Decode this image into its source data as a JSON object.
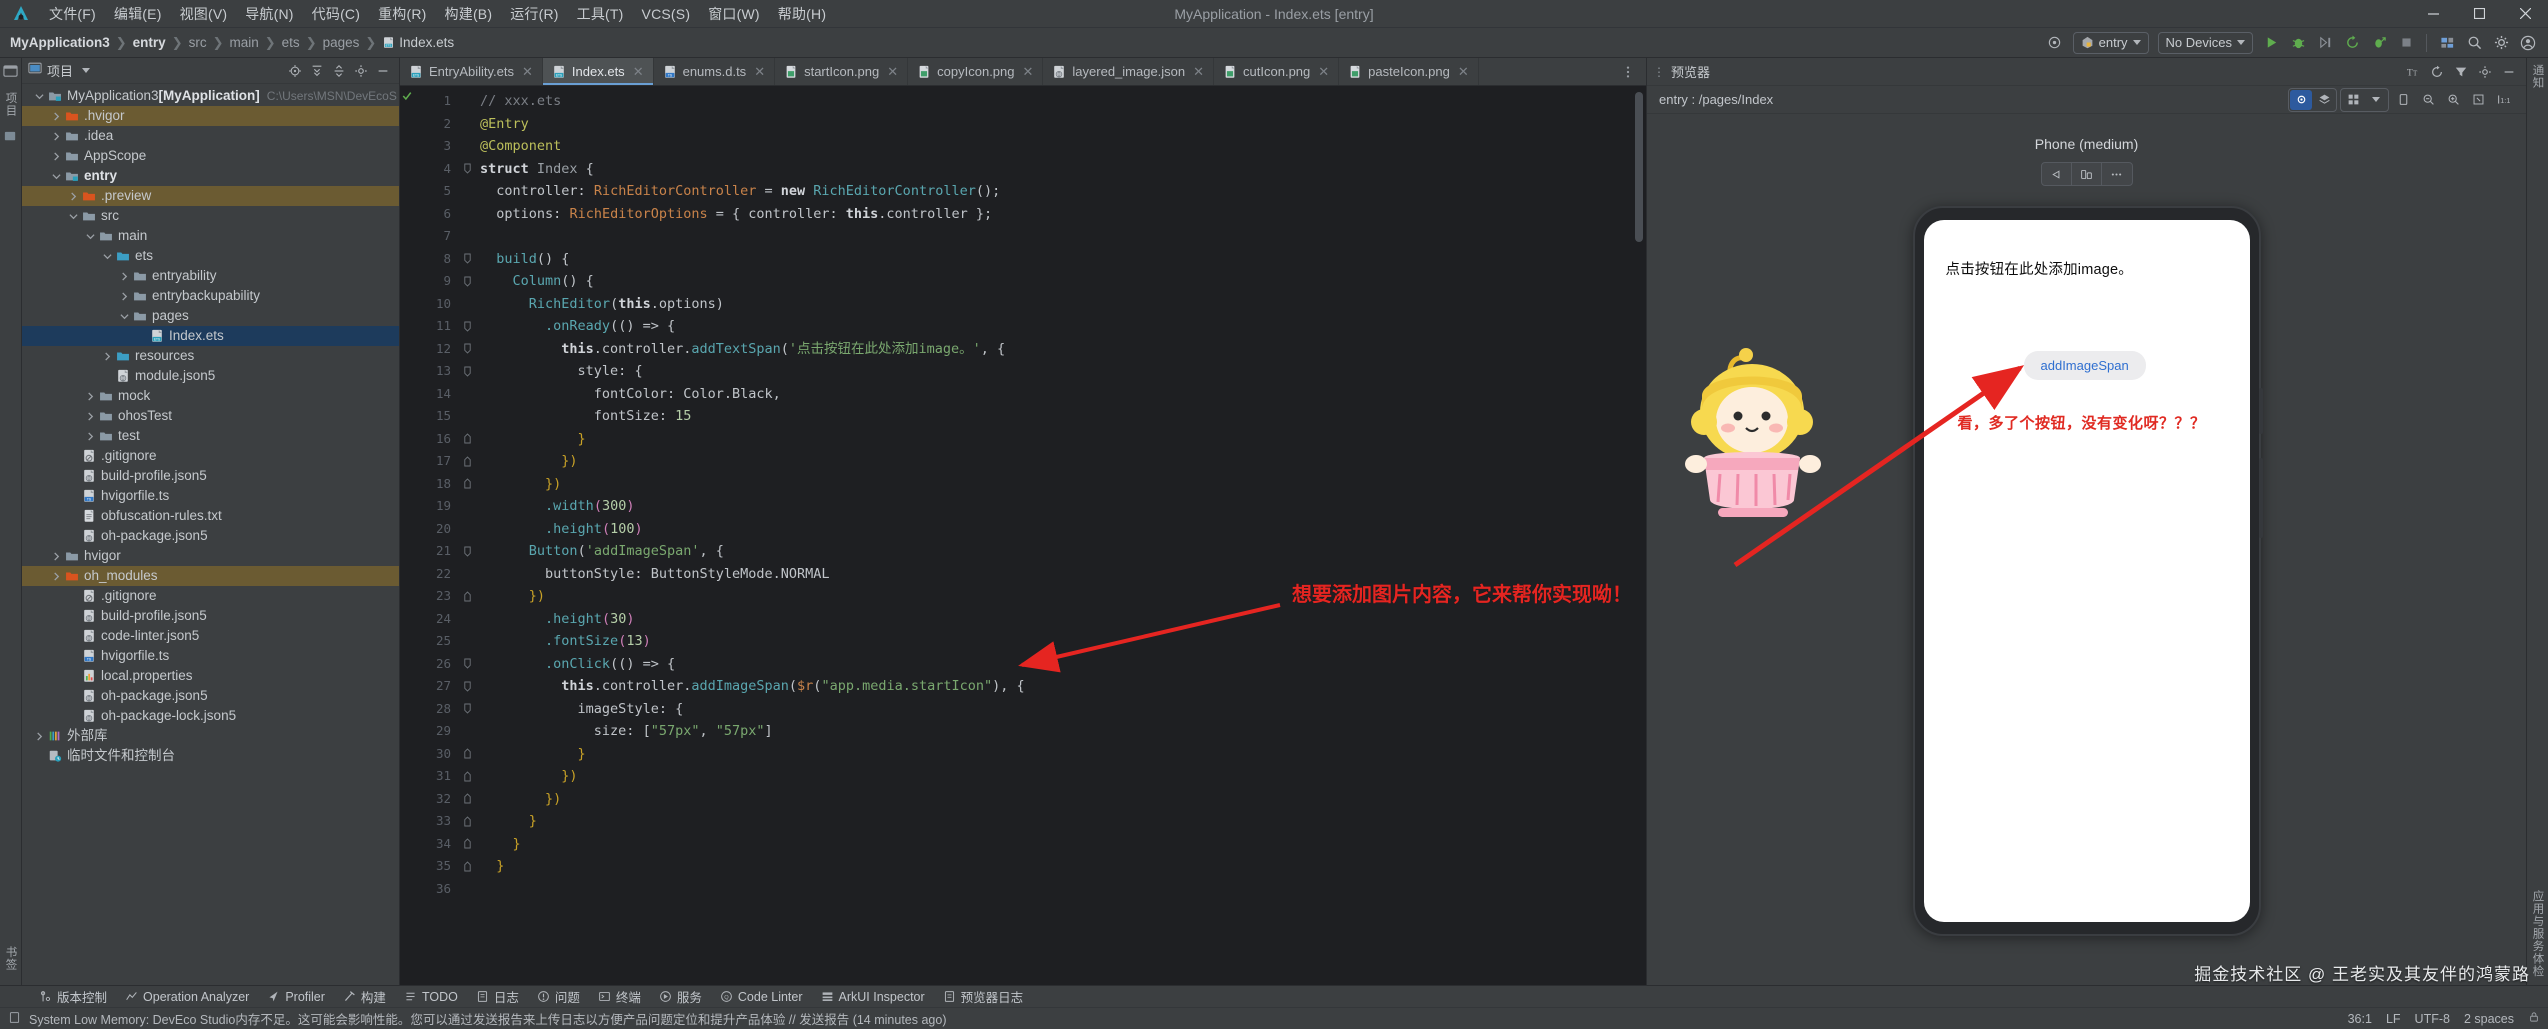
{
  "window": {
    "title": "MyApplication - Index.ets [entry]",
    "menu": [
      "文件(F)",
      "编辑(E)",
      "视图(V)",
      "导航(N)",
      "代码(C)",
      "重构(R)",
      "构建(B)",
      "运行(R)",
      "工具(T)",
      "VCS(S)",
      "窗口(W)",
      "帮助(H)"
    ],
    "controls": {
      "minimize": "minimize-icon",
      "maximize": "maximize-icon",
      "close": "close-icon"
    }
  },
  "navbar": {
    "breadcrumb": [
      "MyApplication3",
      "entry",
      "src",
      "main",
      "ets",
      "pages",
      "Index.ets"
    ],
    "run_config": "entry",
    "device": "No Devices",
    "icons": [
      "settings-target-icon",
      "run-icon",
      "debug-icon",
      "profile-run-icon",
      "rerun-icon",
      "attach-debugger-icon",
      "stop-icon",
      "device-manager-icon",
      "search-everywhere-icon",
      "settings-gear-icon",
      "account-icon"
    ]
  },
  "left_rail": {
    "items": [
      "项目",
      "结构",
      "书签"
    ]
  },
  "project_panel": {
    "title": "项目",
    "header_icons": [
      "locate-icon",
      "expand-all-icon",
      "collapse-all-icon",
      "settings-icon",
      "hide-icon"
    ],
    "tree": [
      {
        "depth": 0,
        "label": "MyApplication3",
        "bold_label": "[MyApplication]",
        "path": "C:\\Users\\MSN\\DevEcoS",
        "icon": "module-folder",
        "arrow": "down",
        "state": "normal"
      },
      {
        "depth": 1,
        "label": ".hvigor",
        "icon": "folder-orange",
        "arrow": "right",
        "state": "hl"
      },
      {
        "depth": 1,
        "label": ".idea",
        "icon": "folder",
        "arrow": "right",
        "state": "normal"
      },
      {
        "depth": 1,
        "label": "AppScope",
        "icon": "folder",
        "arrow": "right",
        "state": "normal"
      },
      {
        "depth": 1,
        "label": "entry",
        "icon": "module-folder",
        "arrow": "down",
        "state": "normal",
        "bold": true
      },
      {
        "depth": 2,
        "label": ".preview",
        "icon": "folder-orange",
        "arrow": "right",
        "state": "hl"
      },
      {
        "depth": 2,
        "label": "src",
        "icon": "folder",
        "arrow": "down",
        "state": "normal"
      },
      {
        "depth": 3,
        "label": "main",
        "icon": "folder",
        "arrow": "down",
        "state": "normal"
      },
      {
        "depth": 4,
        "label": "ets",
        "icon": "folder-blue",
        "arrow": "down",
        "state": "normal"
      },
      {
        "depth": 5,
        "label": "entryability",
        "icon": "folder",
        "arrow": "right",
        "state": "normal"
      },
      {
        "depth": 5,
        "label": "entrybackupability",
        "icon": "folder",
        "arrow": "right",
        "state": "normal"
      },
      {
        "depth": 5,
        "label": "pages",
        "icon": "folder",
        "arrow": "down",
        "state": "normal"
      },
      {
        "depth": 6,
        "label": "Index.ets",
        "icon": "ets-file",
        "arrow": "none",
        "state": "sel"
      },
      {
        "depth": 4,
        "label": "resources",
        "icon": "folder-blue",
        "arrow": "right",
        "state": "normal"
      },
      {
        "depth": 4,
        "label": "module.json5",
        "icon": "json5-file",
        "arrow": "none",
        "state": "normal"
      },
      {
        "depth": 3,
        "label": "mock",
        "icon": "folder",
        "arrow": "right",
        "state": "normal"
      },
      {
        "depth": 3,
        "label": "ohosTest",
        "icon": "folder",
        "arrow": "right",
        "state": "normal"
      },
      {
        "depth": 3,
        "label": "test",
        "icon": "folder",
        "arrow": "right",
        "state": "normal"
      },
      {
        "depth": 2,
        "label": ".gitignore",
        "icon": "gitignore-file",
        "arrow": "none",
        "state": "normal"
      },
      {
        "depth": 2,
        "label": "build-profile.json5",
        "icon": "json5-file",
        "arrow": "none",
        "state": "normal"
      },
      {
        "depth": 2,
        "label": "hvigorfile.ts",
        "icon": "ts-file",
        "arrow": "none",
        "state": "normal"
      },
      {
        "depth": 2,
        "label": "obfuscation-rules.txt",
        "icon": "txt-file",
        "arrow": "none",
        "state": "normal"
      },
      {
        "depth": 2,
        "label": "oh-package.json5",
        "icon": "json5-file",
        "arrow": "none",
        "state": "normal"
      },
      {
        "depth": 1,
        "label": "hvigor",
        "icon": "folder",
        "arrow": "right",
        "state": "normal"
      },
      {
        "depth": 1,
        "label": "oh_modules",
        "icon": "folder-orange",
        "arrow": "right",
        "state": "hl"
      },
      {
        "depth": 2,
        "label": ".gitignore",
        "icon": "gitignore-file",
        "arrow": "none",
        "state": "normal"
      },
      {
        "depth": 2,
        "label": "build-profile.json5",
        "icon": "json5-file",
        "arrow": "none",
        "state": "normal"
      },
      {
        "depth": 2,
        "label": "code-linter.json5",
        "icon": "json5-file",
        "arrow": "none",
        "state": "normal"
      },
      {
        "depth": 2,
        "label": "hvigorfile.ts",
        "icon": "ts-file",
        "arrow": "none",
        "state": "normal"
      },
      {
        "depth": 2,
        "label": "local.properties",
        "icon": "properties-file",
        "arrow": "none",
        "state": "normal"
      },
      {
        "depth": 2,
        "label": "oh-package.json5",
        "icon": "json5-file",
        "arrow": "none",
        "state": "normal"
      },
      {
        "depth": 2,
        "label": "oh-package-lock.json5",
        "icon": "json5-file",
        "arrow": "none",
        "state": "normal"
      },
      {
        "depth": 0,
        "label": "外部库",
        "icon": "library-icon",
        "arrow": "right",
        "state": "normal"
      },
      {
        "depth": 0,
        "label": "临时文件和控制台",
        "icon": "scratches-icon",
        "arrow": "none",
        "state": "normal"
      }
    ]
  },
  "editor": {
    "tabs": [
      {
        "label": "EntryAbility.ets",
        "icon": "ets-file",
        "active": false
      },
      {
        "label": "Index.ets",
        "icon": "ets-file",
        "active": true
      },
      {
        "label": "enums.d.ts",
        "icon": "ts-file",
        "active": false
      },
      {
        "label": "startIcon.png",
        "icon": "png-file",
        "active": false
      },
      {
        "label": "copyIcon.png",
        "icon": "png-file",
        "active": false
      },
      {
        "label": "layered_image.json",
        "icon": "json-file",
        "active": false
      },
      {
        "label": "cutIcon.png",
        "icon": "png-file",
        "active": false
      },
      {
        "label": "pasteIcon.png",
        "icon": "png-file",
        "active": false
      }
    ],
    "first_line": 1,
    "last_line": 36,
    "lines": [
      {
        "n": 1,
        "indent": 0,
        "tokens": [
          {
            "t": "// xxx.ets",
            "c": "k-cmt"
          }
        ]
      },
      {
        "n": 2,
        "indent": 0,
        "tokens": [
          {
            "t": "@Entry",
            "c": "k-ann"
          }
        ]
      },
      {
        "n": 3,
        "indent": 0,
        "tokens": [
          {
            "t": "@Component",
            "c": "k-ann"
          }
        ]
      },
      {
        "n": 4,
        "indent": 0,
        "fold": "open",
        "tokens": [
          {
            "t": "struct ",
            "c": "k-kw"
          },
          {
            "t": "Index",
            "c": "k-id"
          },
          {
            "t": " {",
            "c": "k-plain"
          }
        ]
      },
      {
        "n": 5,
        "indent": 1,
        "tokens": [
          {
            "t": "controller",
            "c": "k-plain"
          },
          {
            "t": ": ",
            "c": "k-plain"
          },
          {
            "t": "RichEditorController",
            "c": "k-type"
          },
          {
            "t": " = ",
            "c": "k-plain"
          },
          {
            "t": "new ",
            "c": "k-kw"
          },
          {
            "t": "RichEditorController",
            "c": "k-fn"
          },
          {
            "t": "();",
            "c": "k-plain"
          }
        ]
      },
      {
        "n": 6,
        "indent": 1,
        "tokens": [
          {
            "t": "options",
            "c": "k-plain"
          },
          {
            "t": ": ",
            "c": "k-plain"
          },
          {
            "t": "RichEditorOptions",
            "c": "k-type"
          },
          {
            "t": " = { controller: ",
            "c": "k-plain"
          },
          {
            "t": "this",
            "c": "k-kw"
          },
          {
            "t": ".controller };",
            "c": "k-plain"
          }
        ]
      },
      {
        "n": 7,
        "indent": 0,
        "tokens": []
      },
      {
        "n": 8,
        "indent": 1,
        "fold": "open",
        "tokens": [
          {
            "t": "build",
            "c": "k-fn"
          },
          {
            "t": "() {",
            "c": "k-plain"
          }
        ]
      },
      {
        "n": 9,
        "indent": 2,
        "fold": "open",
        "tokens": [
          {
            "t": "Column",
            "c": "k-fn"
          },
          {
            "t": "() {",
            "c": "k-plain"
          }
        ]
      },
      {
        "n": 10,
        "indent": 3,
        "tokens": [
          {
            "t": "RichEditor",
            "c": "k-fn"
          },
          {
            "t": "(",
            "c": "k-plain"
          },
          {
            "t": "this",
            "c": "k-kw"
          },
          {
            "t": ".options)",
            "c": "k-plain"
          }
        ]
      },
      {
        "n": 11,
        "indent": 4,
        "fold": "open",
        "tokens": [
          {
            "t": ".onReady",
            "c": "k-fn"
          },
          {
            "t": "(() => {",
            "c": "k-plain"
          }
        ]
      },
      {
        "n": 12,
        "indent": 5,
        "fold": "open",
        "tokens": [
          {
            "t": "this",
            "c": "k-kw"
          },
          {
            "t": ".controller.",
            "c": "k-plain"
          },
          {
            "t": "addTextSpan",
            "c": "k-fn"
          },
          {
            "t": "(",
            "c": "k-plain"
          },
          {
            "t": "'点击按钮在此处添加image。'",
            "c": "k-str"
          },
          {
            "t": ", {",
            "c": "k-plain"
          }
        ]
      },
      {
        "n": 13,
        "indent": 6,
        "fold": "open",
        "tokens": [
          {
            "t": "style: {",
            "c": "k-plain"
          }
        ]
      },
      {
        "n": 14,
        "indent": 7,
        "tokens": [
          {
            "t": "fontColor: Color.Black,",
            "c": "k-plain"
          }
        ]
      },
      {
        "n": 15,
        "indent": 7,
        "tokens": [
          {
            "t": "fontSize: ",
            "c": "k-plain"
          },
          {
            "t": "15",
            "c": "k-num"
          }
        ]
      },
      {
        "n": 16,
        "indent": 6,
        "fold": "close",
        "tokens": [
          {
            "t": "}",
            "c": "k-brk"
          }
        ]
      },
      {
        "n": 17,
        "indent": 5,
        "fold": "close",
        "tokens": [
          {
            "t": "})",
            "c": "k-brk"
          }
        ]
      },
      {
        "n": 18,
        "indent": 4,
        "fold": "close",
        "tokens": [
          {
            "t": "})",
            "c": "k-brk"
          }
        ]
      },
      {
        "n": 19,
        "indent": 4,
        "tokens": [
          {
            "t": ".width",
            "c": "k-fn"
          },
          {
            "t": "(",
            "c": "k-paren-pink"
          },
          {
            "t": "300",
            "c": "k-num"
          },
          {
            "t": ")",
            "c": "k-paren-pink"
          }
        ]
      },
      {
        "n": 20,
        "indent": 4,
        "tokens": [
          {
            "t": ".height",
            "c": "k-fn"
          },
          {
            "t": "(",
            "c": "k-paren-pink"
          },
          {
            "t": "100",
            "c": "k-num"
          },
          {
            "t": ")",
            "c": "k-paren-pink"
          }
        ]
      },
      {
        "n": 21,
        "indent": 3,
        "fold": "open",
        "tokens": [
          {
            "t": "Button",
            "c": "k-fn"
          },
          {
            "t": "(",
            "c": "k-plain"
          },
          {
            "t": "'addImageSpan'",
            "c": "k-str"
          },
          {
            "t": ", {",
            "c": "k-plain"
          }
        ]
      },
      {
        "n": 22,
        "indent": 4,
        "tokens": [
          {
            "t": "buttonStyle: ButtonStyleMode.NORMAL",
            "c": "k-plain"
          }
        ]
      },
      {
        "n": 23,
        "indent": 3,
        "fold": "close",
        "tokens": [
          {
            "t": "})",
            "c": "k-brk"
          }
        ]
      },
      {
        "n": 24,
        "indent": 4,
        "tokens": [
          {
            "t": ".height",
            "c": "k-fn"
          },
          {
            "t": "(",
            "c": "k-paren-pink"
          },
          {
            "t": "30",
            "c": "k-num"
          },
          {
            "t": ")",
            "c": "k-paren-pink"
          }
        ]
      },
      {
        "n": 25,
        "indent": 4,
        "tokens": [
          {
            "t": ".fontSize",
            "c": "k-fn"
          },
          {
            "t": "(",
            "c": "k-paren-pink"
          },
          {
            "t": "13",
            "c": "k-num"
          },
          {
            "t": ")",
            "c": "k-paren-pink"
          }
        ]
      },
      {
        "n": 26,
        "indent": 4,
        "fold": "open",
        "tokens": [
          {
            "t": ".onClick",
            "c": "k-fn"
          },
          {
            "t": "(() => {",
            "c": "k-plain"
          }
        ]
      },
      {
        "n": 27,
        "indent": 5,
        "fold": "open",
        "tokens": [
          {
            "t": "this",
            "c": "k-kw"
          },
          {
            "t": ".controller.",
            "c": "k-plain"
          },
          {
            "t": "addImageSpan",
            "c": "k-fn"
          },
          {
            "t": "(",
            "c": "k-plain"
          },
          {
            "t": "$r",
            "c": "k-dollar"
          },
          {
            "t": "(",
            "c": "k-plain"
          },
          {
            "t": "\"app.media.startIcon\"",
            "c": "k-str"
          },
          {
            "t": "), {",
            "c": "k-plain"
          }
        ]
      },
      {
        "n": 28,
        "indent": 6,
        "fold": "open",
        "tokens": [
          {
            "t": "imageStyle: {",
            "c": "k-plain"
          }
        ]
      },
      {
        "n": 29,
        "indent": 7,
        "tokens": [
          {
            "t": "size: [",
            "c": "k-plain"
          },
          {
            "t": "\"57px\"",
            "c": "k-str"
          },
          {
            "t": ", ",
            "c": "k-plain"
          },
          {
            "t": "\"57px\"",
            "c": "k-str"
          },
          {
            "t": "]",
            "c": "k-plain"
          }
        ]
      },
      {
        "n": 30,
        "indent": 6,
        "fold": "close",
        "tokens": [
          {
            "t": "}",
            "c": "k-brk"
          }
        ]
      },
      {
        "n": 31,
        "indent": 5,
        "fold": "close",
        "tokens": [
          {
            "t": "})",
            "c": "k-brk"
          }
        ]
      },
      {
        "n": 32,
        "indent": 4,
        "fold": "close",
        "tokens": [
          {
            "t": "})",
            "c": "k-brk"
          }
        ]
      },
      {
        "n": 33,
        "indent": 3,
        "fold": "close",
        "tokens": [
          {
            "t": "}",
            "c": "k-brk"
          }
        ]
      },
      {
        "n": 34,
        "indent": 2,
        "fold": "close",
        "tokens": [
          {
            "t": "}",
            "c": "k-brk"
          }
        ]
      },
      {
        "n": 35,
        "indent": 1,
        "fold": "close",
        "tokens": [
          {
            "t": "}",
            "c": "k-brk"
          }
        ]
      },
      {
        "n": 36,
        "indent": 0,
        "tokens": []
      }
    ]
  },
  "preview": {
    "title": "预览器",
    "route": "entry : /pages/Index",
    "device_name": "Phone (medium)",
    "header_icons": [
      "text-size-icon",
      "refresh-icon",
      "filter-icon",
      "settings-icon",
      "hide-icon"
    ],
    "sub_icons": [
      "inspector-icon",
      "layers-icon",
      "grid-icon",
      "chevron-down-icon",
      "device-frame-icon",
      "zoom-out-icon",
      "zoom-in-icon",
      "fit-screen-icon",
      "actual-size-icon"
    ],
    "mini_icons": [
      "rotate-left-icon",
      "orientation-icon",
      "more-icon"
    ],
    "screen": {
      "rich_text": "点击按钮在此处添加image。",
      "button_label": "addImageSpan",
      "note": "看，多了个按钮，没有变化呀？？？"
    }
  },
  "right_rail": {
    "items": [
      "通知",
      "应用与服务体检"
    ]
  },
  "annotations": {
    "editor_note": "想要添加图片内容，它来帮你实现呦！",
    "watermark": "掘金技术社区 @ 王老实及其友伴的鸿蒙路",
    "arrow_color": "#e52521"
  },
  "bottom": {
    "tool_windows": [
      {
        "label": "版本控制",
        "icon": "vcs-icon"
      },
      {
        "label": "Operation Analyzer",
        "icon": "analyzer-icon"
      },
      {
        "label": "Profiler",
        "icon": "profiler-icon"
      },
      {
        "label": "构建",
        "icon": "build-icon"
      },
      {
        "label": "TODO",
        "icon": "todo-icon"
      },
      {
        "label": "日志",
        "icon": "log-icon"
      },
      {
        "label": "问题",
        "icon": "problems-icon"
      },
      {
        "label": "终端",
        "icon": "terminal-icon"
      },
      {
        "label": "服务",
        "icon": "services-icon"
      },
      {
        "label": "Code Linter",
        "icon": "linter-icon"
      },
      {
        "label": "ArkUI Inspector",
        "icon": "inspector-icon"
      },
      {
        "label": "预览器日志",
        "icon": "preview-log-icon"
      }
    ],
    "status_message": "System Low Memory: DevEco Studio内存不足。这可能会影响性能。您可以通过发送报告来上传日志以方便产品问题定位和提升产品体验 // 发送报告 (14 minutes ago)",
    "right": [
      "36:1",
      "LF",
      "UTF-8",
      "2 spaces"
    ]
  }
}
